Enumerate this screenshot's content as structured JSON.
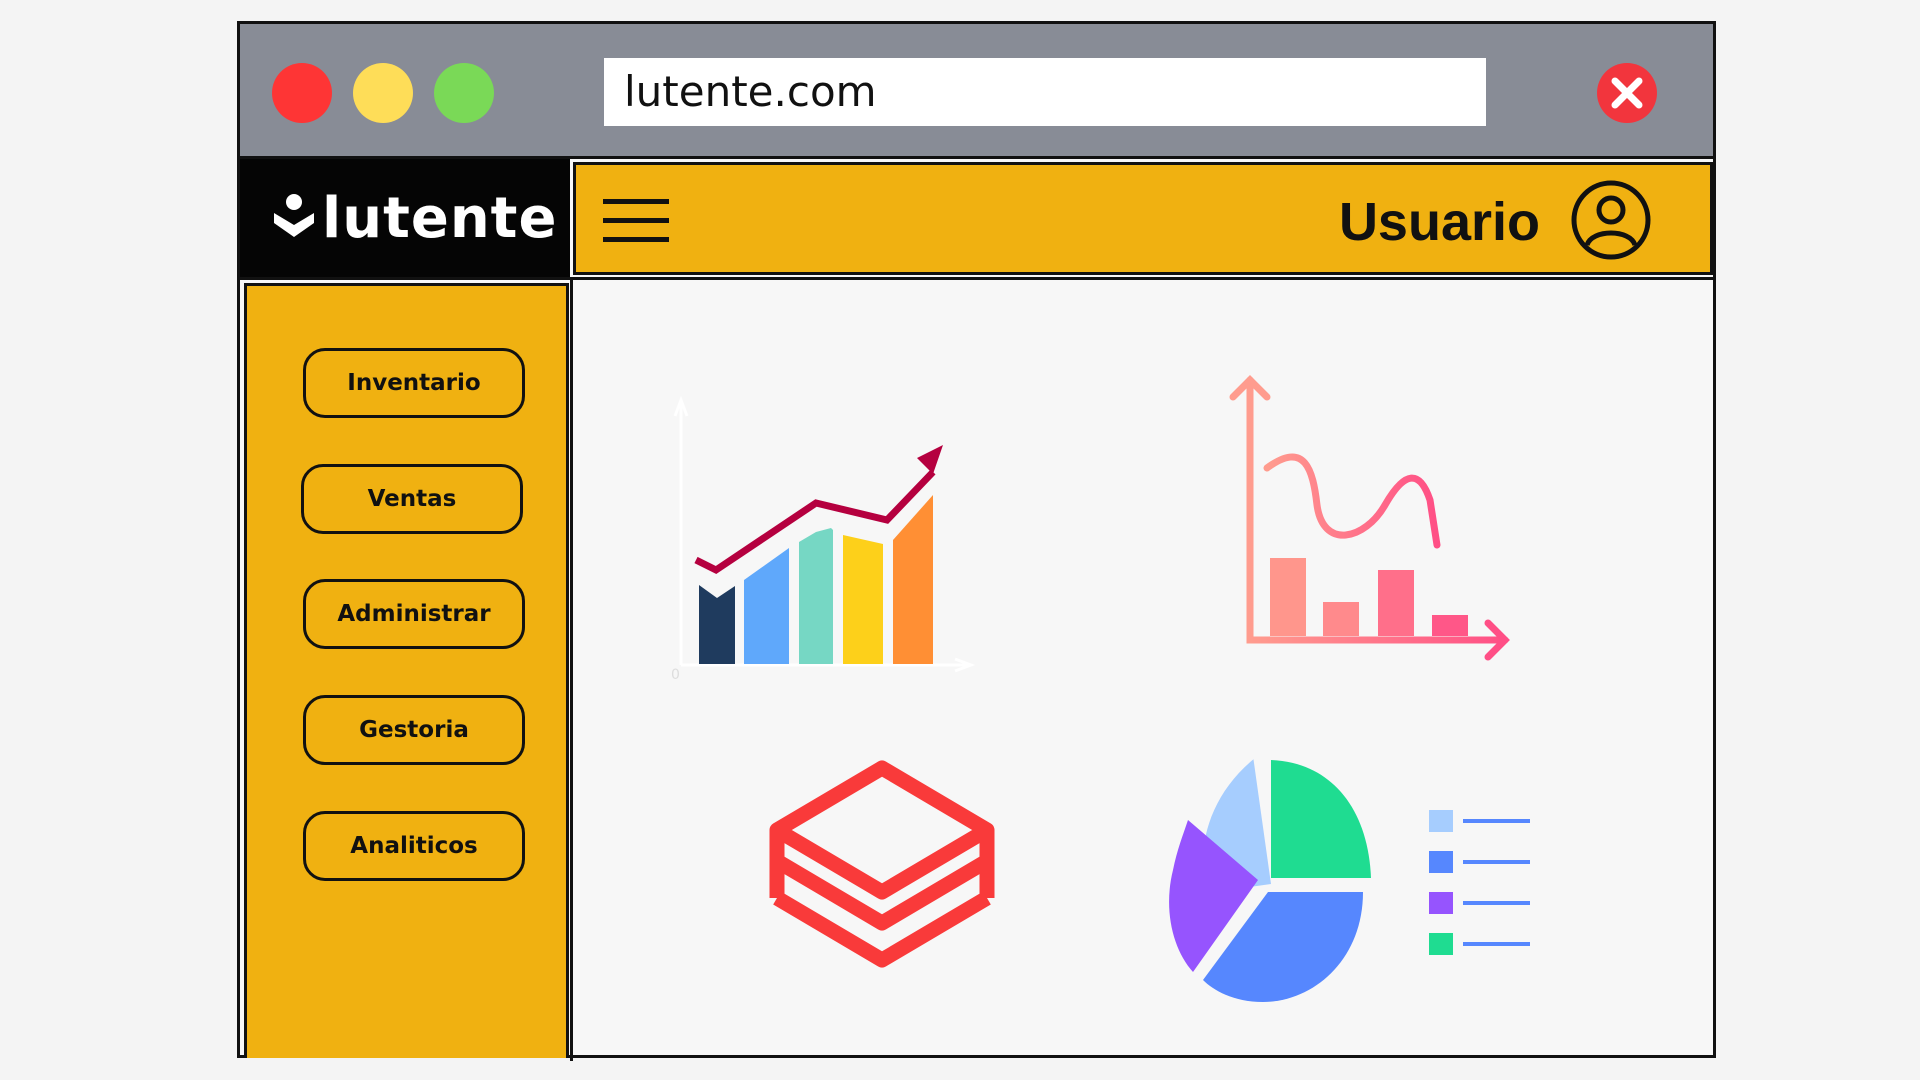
{
  "browser": {
    "url": "lutente.com",
    "traffic_lights": [
      "#fe3535",
      "#fedd58",
      "#7ad957"
    ],
    "close_icon": "close-x-icon"
  },
  "app": {
    "logo_text": "lutente",
    "user_label": "Usuario",
    "accent_color": "#f0b111"
  },
  "sidebar": {
    "items": [
      {
        "label": "Inventario"
      },
      {
        "label": "Ventas"
      },
      {
        "label": "Administrar"
      },
      {
        "label": "Gestoria"
      },
      {
        "label": "Analiticos"
      }
    ]
  },
  "dashboard": {
    "tiles": [
      {
        "icon": "bar-chart-growth-icon"
      },
      {
        "icon": "line-bar-chart-icon"
      },
      {
        "icon": "layers-icon"
      },
      {
        "icon": "pie-chart-legend-icon"
      }
    ],
    "bar_chart_axis_zero": "0"
  }
}
